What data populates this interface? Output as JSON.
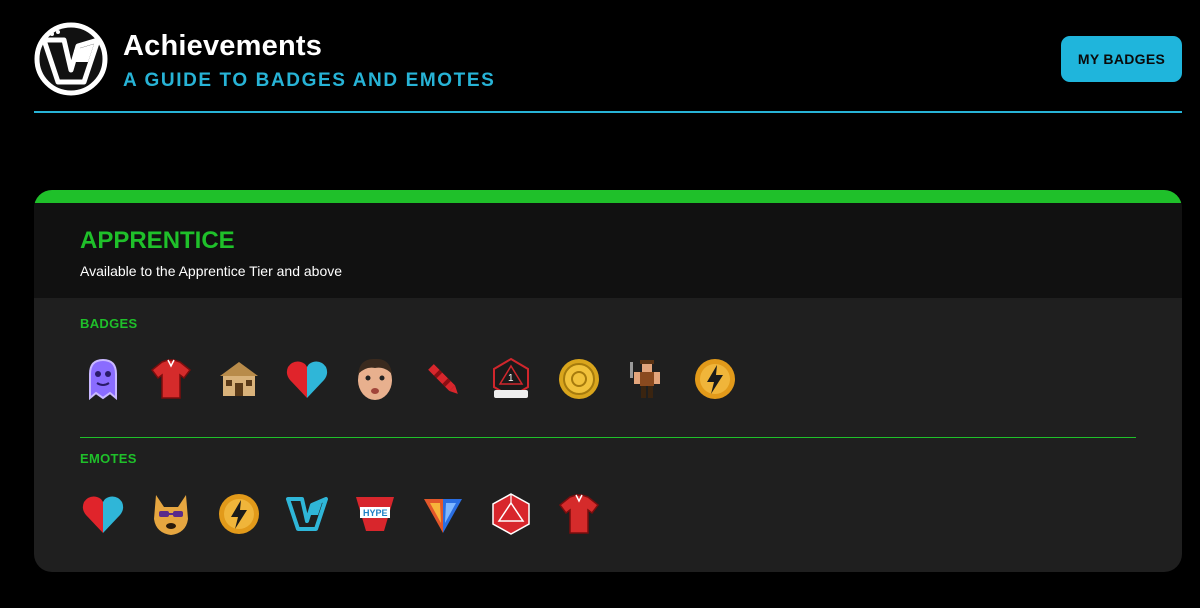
{
  "header": {
    "title": "Achievements",
    "subtitle": "A GUIDE TO BADGES AND EMOTES",
    "my_badges_label": "MY BADGES"
  },
  "tier": {
    "name": "APPRENTICE",
    "description": "Available to the Apprentice Tier and above"
  },
  "badges": {
    "label": "BADGES",
    "items": [
      "ghost-badge-icon",
      "red-jersey-badge-icon",
      "hut-badge-icon",
      "split-heart-badge-icon",
      "face-badge-icon",
      "crayon-badge-icon",
      "d20-dice-badge-icon",
      "gold-coin-badge-icon",
      "pixel-warrior-badge-icon",
      "lightning-coin-badge-icon"
    ]
  },
  "emotes": {
    "label": "EMOTES",
    "items": [
      "split-heart-emote-icon",
      "dog-sunglasses-emote-icon",
      "lightning-coin-emote-icon",
      "logo-emote-icon",
      "hype-emote-icon",
      "fire-ice-logo-emote-icon",
      "d20-red-emote-icon",
      "red-jersey-emote-icon"
    ]
  },
  "colors": {
    "accent_blue": "#27b3d6",
    "tier_green": "#1fc02a",
    "card_bg": "#1f1f1f",
    "page_bg": "#000000"
  }
}
